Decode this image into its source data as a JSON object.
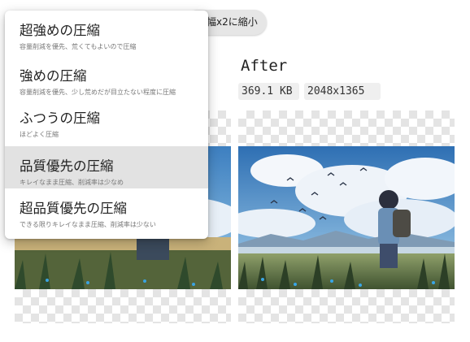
{
  "toolbar": {
    "chip_label": "幅x2に縮小"
  },
  "after": {
    "title": "After",
    "file_size": "369.1 KB",
    "dimensions": "2048x1365"
  },
  "compression_menu": {
    "items": [
      {
        "label": "超強めの圧縮",
        "description": "容量削減を優先、荒くてもよいので圧縮",
        "selected": false
      },
      {
        "label": "強めの圧縮",
        "description": "容量削減を優先、少し荒めだが目立たない程度に圧縮",
        "selected": false
      },
      {
        "label": "ふつうの圧縮",
        "description": "ほどよく圧縮",
        "selected": false
      },
      {
        "label": "品質優先の圧縮",
        "description": "キレイなまま圧縮、削減率は少なめ",
        "selected": true
      },
      {
        "label": "超品質優先の圧縮",
        "description": "できる限りキレイなまま圧縮、削減率は少ない",
        "selected": false
      }
    ]
  },
  "colors": {
    "menu_selected": "#e2e2e2",
    "checker": "#e4e4e4",
    "chip": "#e6e6e6"
  },
  "icons": {
    "preview_image": "anime-landscape-image"
  }
}
